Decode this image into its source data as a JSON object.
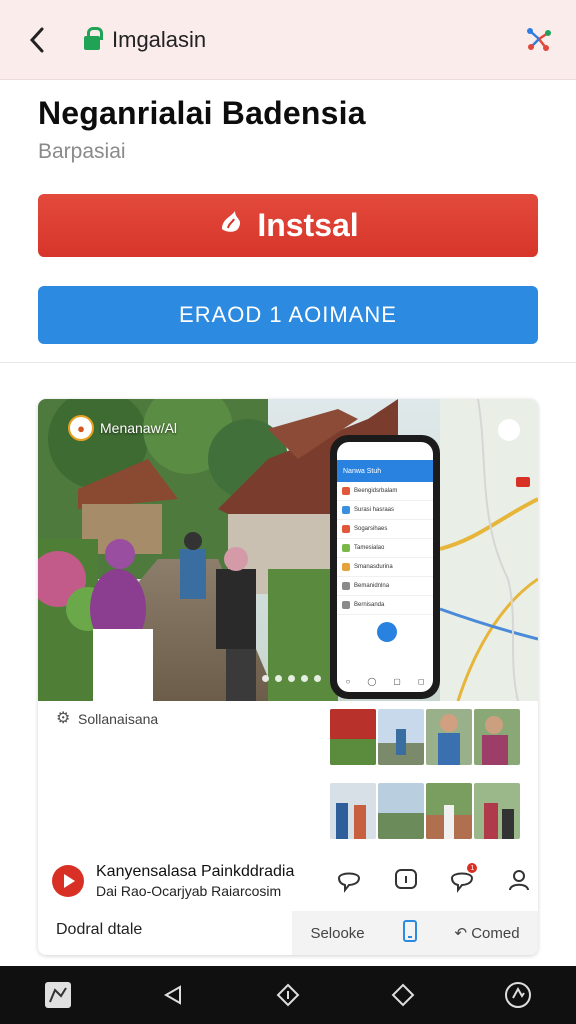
{
  "browser": {
    "url_text": "Imgalasin",
    "back_icon": "chevron-left-icon",
    "lock_icon": "lock-icon",
    "menu_icon": "share-menu-icon"
  },
  "app": {
    "title": "Neganrialai Badensia",
    "subtitle": "Barpasiai",
    "install_label": "Instsal",
    "secondary_button_label": "ERAOD 1 AOIMANE"
  },
  "card": {
    "brand_name": "Menanaw/Al",
    "phone_header": "Nanwa Stuh",
    "phone_rows": [
      "Beengidsrbalam",
      "Surasi hasraas",
      "Sogarsihaes",
      "Tamesialao",
      "Smanasdurina",
      "Bemanidnlna",
      "Bernisanda"
    ],
    "phone_row_colors": [
      "#e2563a",
      "#3a8fe0",
      "#e2563a",
      "#7bb84a",
      "#e5a23a",
      "#8a8a8a",
      "#8a8a8a"
    ],
    "meta_label": "Sollanaisana",
    "video_title": "Kanyensalasa Painkddradia",
    "video_subtitle": "Dai Rao-Ocarjyab Raiarcosim",
    "footer_label": "Dodral dtale",
    "footer_actions": [
      "Selooke",
      "Comed"
    ],
    "notification_count": "1",
    "accent_red": "#d93025",
    "accent_blue": "#2c8ae0"
  },
  "nav": {
    "buttons": [
      "app-drawer-icon",
      "back-nav-icon",
      "home-icon",
      "recent-icon",
      "assistant-icon"
    ]
  }
}
